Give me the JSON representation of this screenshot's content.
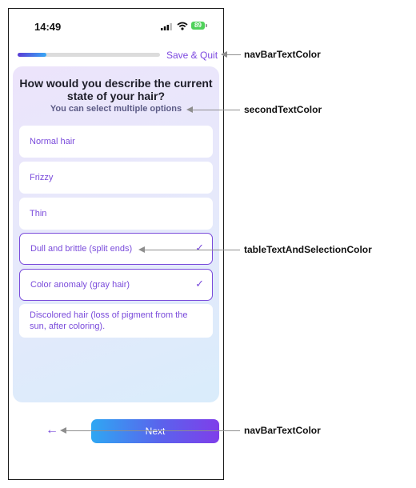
{
  "status_bar": {
    "time": "14:49",
    "battery": "89"
  },
  "header": {
    "save_quit": "Save & Quit",
    "progress": 0.2
  },
  "question": {
    "title": "How would you describe the current state of your hair?",
    "subtitle": "You can select multiple options"
  },
  "options": [
    {
      "label": "Normal hair",
      "selected": false
    },
    {
      "label": "Frizzy",
      "selected": false
    },
    {
      "label": "Thin",
      "selected": false
    },
    {
      "label": "Dull and brittle (split ends)",
      "selected": true
    },
    {
      "label": "Color anomaly (gray hair)",
      "selected": true
    },
    {
      "label": "Discolored hair (loss of pigment from the sun, after coloring).",
      "selected": false
    }
  ],
  "footer": {
    "back_icon": "arrow-left-icon",
    "next_label": "Next"
  },
  "annotations": {
    "save_quit": "navBarTextColor",
    "subtitle": "secondTextColor",
    "selection": "tableTextAndSelectionColor",
    "back": "navBarTextColor"
  },
  "colors": {
    "accent": "#7a4bdb",
    "subtitle": "#5c5b86",
    "battery": "#4fd15a"
  }
}
